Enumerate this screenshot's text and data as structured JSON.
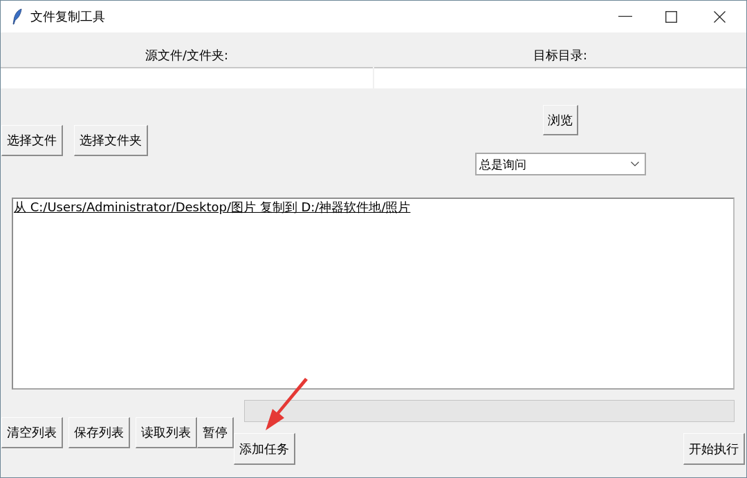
{
  "window": {
    "title": "文件复制工具"
  },
  "source": {
    "label": "源文件/文件夹:",
    "buttons": [
      "选择文件",
      "选择文件夹"
    ]
  },
  "target": {
    "label": "目标目录:",
    "browse_button": "浏览",
    "conflict_option": {
      "value": "总是询问"
    }
  },
  "task_list": {
    "items": [
      {
        "text": "从 C:/Users/Administrator/Desktop/图片 复制到 D:/神器软件地/照片",
        "active": true
      }
    ]
  },
  "progress": {
    "level": 0
  },
  "list_buttons": [
    "清空列表",
    "保存列表",
    "读取列表",
    "暂停"
  ],
  "add_task_button": "添加任务",
  "start_button": "开始执行"
}
